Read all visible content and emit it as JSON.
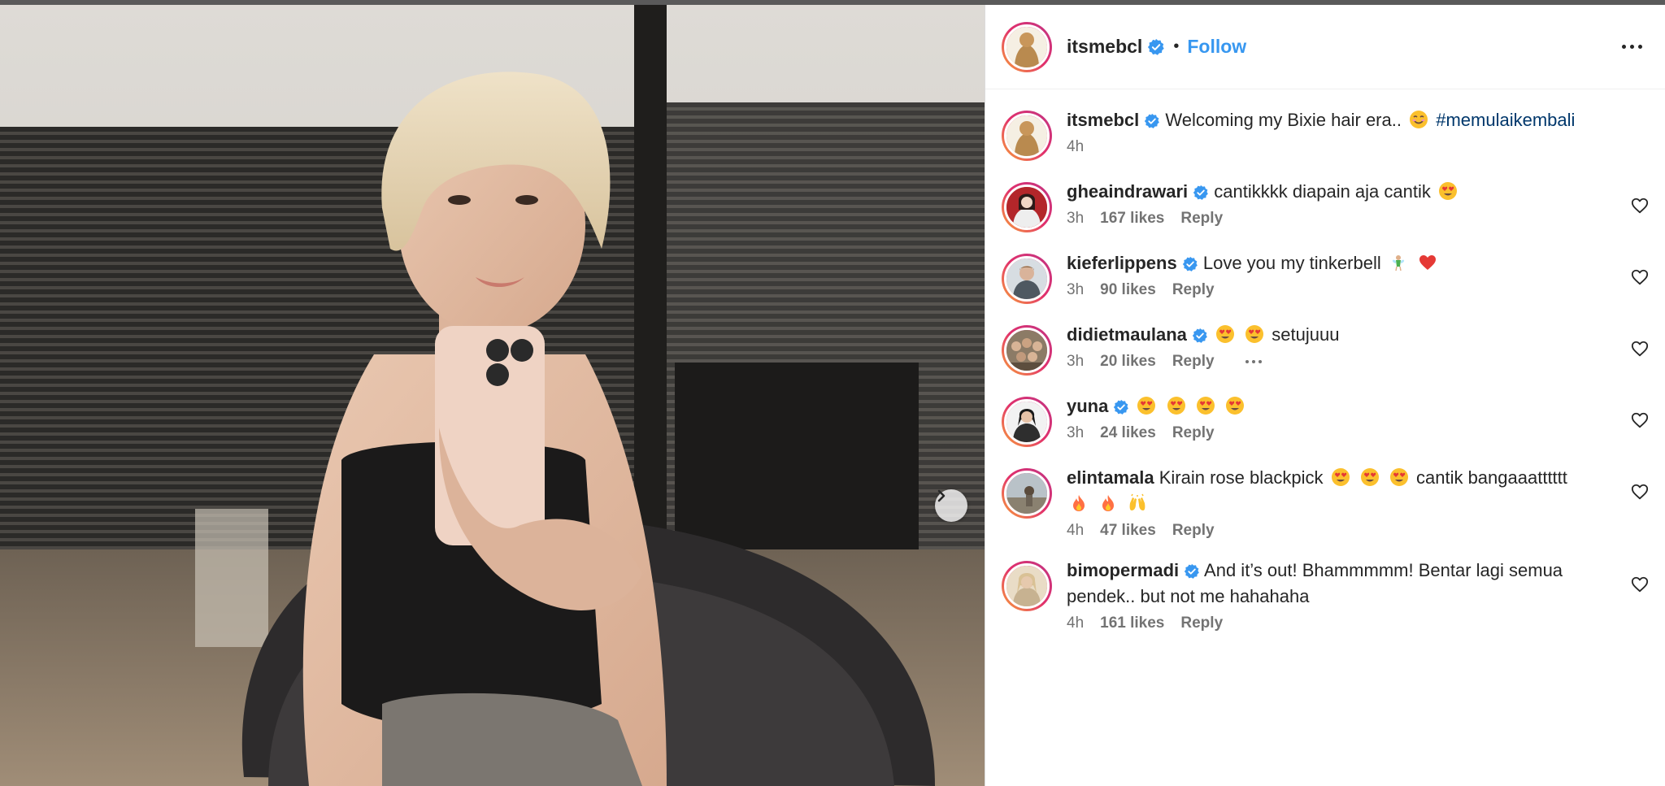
{
  "post": {
    "author": "itsmebcl",
    "separator": "•",
    "follow_label": "Follow",
    "caption": {
      "username": "itsmebcl",
      "text": "Welcoming my Bixie hair era..",
      "emoji": "smiling-face",
      "hashtag": "#memulaikembali",
      "time": "4h"
    }
  },
  "comments": [
    {
      "username": "gheaindrawari",
      "verified": true,
      "text": "cantikkkk diapain aja cantik",
      "emojis_after": [
        "heart-eyes"
      ],
      "time": "3h",
      "likes": "167 likes",
      "reply": "Reply",
      "avatar_color": "#b3262a"
    },
    {
      "username": "kieferlippens",
      "verified": true,
      "text": "Love you my tinkerbell",
      "emojis_after": [
        "fairy",
        "red-heart"
      ],
      "time": "3h",
      "likes": "90 likes",
      "reply": "Reply",
      "avatar_color": "#8a8f95"
    },
    {
      "username": "didietmaulana",
      "verified": true,
      "text_before_emojis": [
        "heart-eyes",
        "heart-eyes"
      ],
      "text": "setujuuu",
      "time": "3h",
      "likes": "20 likes",
      "reply": "Reply",
      "show_more": true,
      "avatar_color": "#7d6f5c"
    },
    {
      "username": "yuna",
      "verified": true,
      "text": "",
      "emojis_after": [
        "heart-eyes",
        "heart-eyes",
        "heart-eyes",
        "heart-eyes"
      ],
      "time": "3h",
      "likes": "24 likes",
      "reply": "Reply",
      "avatar_color": "#3d3d3d"
    },
    {
      "username": "elintamala",
      "verified": false,
      "text": "Kirain rose blackpick",
      "emojis_mid": [
        "heart-eyes",
        "heart-eyes",
        "heart-eyes"
      ],
      "text2": "cantik bangaaatttttt",
      "emojis_line2": [
        "fire",
        "fire",
        "raised-hands"
      ],
      "time": "4h",
      "likes": "47 likes",
      "reply": "Reply",
      "avatar_color": "#9aa3a8"
    },
    {
      "username": "bimopermadi",
      "verified": true,
      "text": "And it’s out! Bhammmmm! Bentar lagi semua pendek.. but not me hahahaha",
      "time": "4h",
      "likes": "161 likes",
      "reply": "Reply",
      "avatar_color": "#c9b79a"
    }
  ],
  "colors": {
    "follow": "#3797f0",
    "verified": "#3897f0",
    "hashtag": "#00376b",
    "meta": "#737373"
  }
}
